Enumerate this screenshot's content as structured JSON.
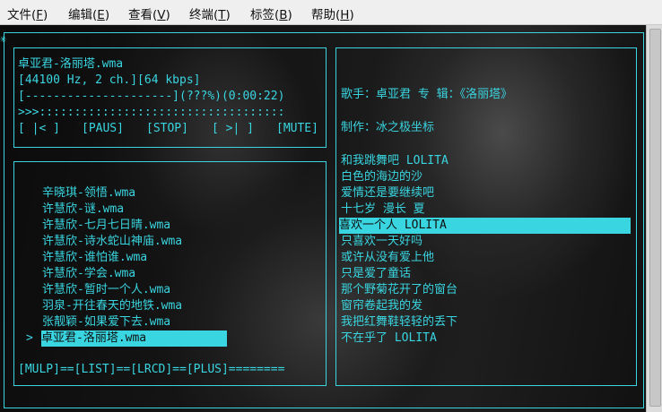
{
  "menu": [
    {
      "label": "文件(",
      "key": "F",
      "end": ")"
    },
    {
      "label": "编辑(",
      "key": "E",
      "end": ")"
    },
    {
      "label": "查看(",
      "key": "V",
      "end": ")"
    },
    {
      "label": "终端(",
      "key": "T",
      "end": ")"
    },
    {
      "label": "标签(",
      "key": "B",
      "end": ")"
    },
    {
      "label": "帮助(",
      "key": "H",
      "end": ")"
    }
  ],
  "player": {
    "title": "卓亚君-洛丽塔.wma",
    "format": "[44100 Hz, 2 ch.][64 kbps]",
    "progress": "[---------------------](???%)(0:00:22)",
    "volume": ">>>:::::::::::::::::::::::::::::::::::",
    "controls": [
      "[ |< ]",
      "[PAUS]",
      "[STOP]",
      "[ >| ]",
      "[MUTE]"
    ]
  },
  "playlist": {
    "items": [
      "辛晓琪-领悟.wma",
      "许慧欣-谜.wma",
      "许慧欣-七月七日晴.wma",
      "许慧欣-诗水蛇山神庙.wma",
      "许慧欣-谁怕谁.wma",
      "许慧欣-学会.wma",
      "许慧欣-暂时一个人.wma",
      "羽泉-开往春天的地铁.wma",
      "张靓颖-如果爱下去.wma",
      "卓亚君-洛丽塔.wma"
    ],
    "current_marker": ">",
    "footer": "[MULP]==[LIST]==[LRCD]==[PLUS]========"
  },
  "lyrics": {
    "header": "歌手：卓亚君 专 辑：《洛丽塔》",
    "credit": "制作：冰之极坐标",
    "lines": [
      "和我跳舞吧 LOLITA",
      "白色的海边的沙",
      "爱情还是要继续吧",
      "十七岁 漫长 夏",
      "喜欢一个人 LOLITA",
      "只喜欢一天好吗",
      "或许从没有爱上他",
      "只是爱了童话",
      "那个野菊花开了的窗台",
      "窗帘卷起我的发",
      "我把红舞鞋轻轻的丢下",
      "不在乎了 LOLITA"
    ],
    "highlighted_index": 4
  },
  "colors": {
    "accent": "#39d5e0",
    "background": "#141414"
  }
}
